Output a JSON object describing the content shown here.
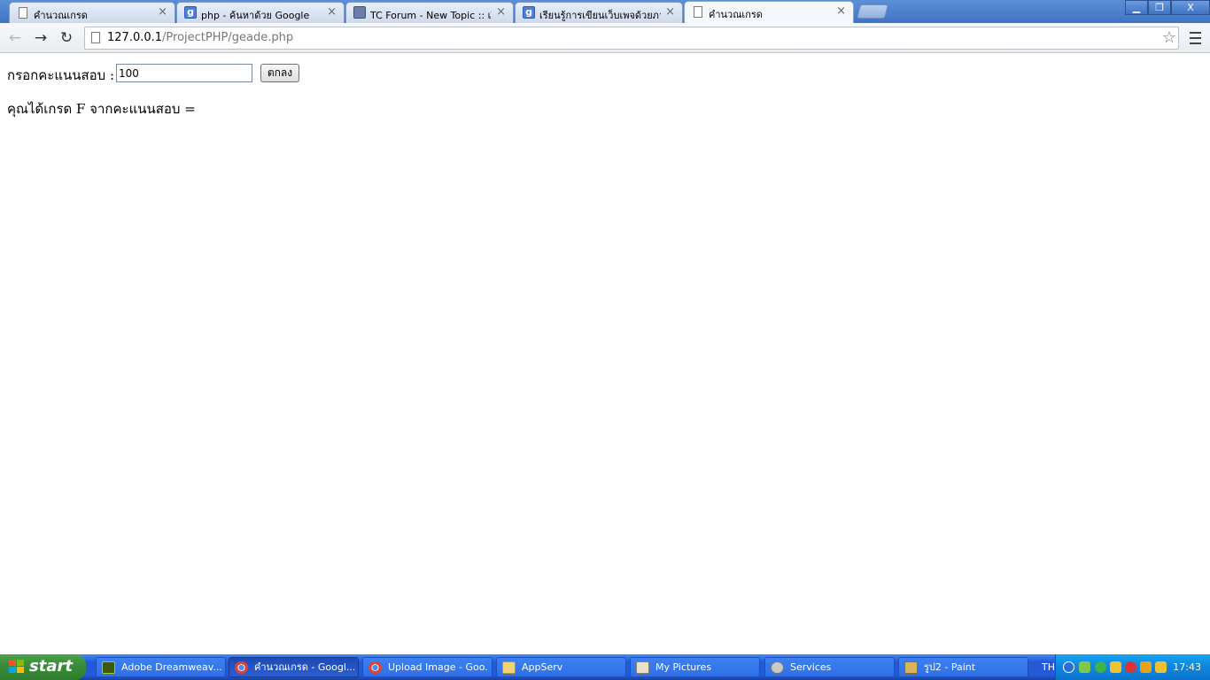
{
  "browser": {
    "tabs": [
      {
        "title": "คำนวณเกรด",
        "icon": "page-icon",
        "active": false
      },
      {
        "title": "php - ค้นหาด้วย Google",
        "icon": "google-icon",
        "active": false
      },
      {
        "title": "TC Forum - New Topic :: เริ่มกร",
        "icon": "forum-icon",
        "active": false
      },
      {
        "title": "เรียนรู้การเขียนเว็บเพจด้วยภาษา",
        "icon": "google-icon",
        "active": false
      },
      {
        "title": "คำนวณเกรด",
        "icon": "page-icon",
        "active": true
      }
    ],
    "tab_close_glyph": "×",
    "window_controls": {
      "minimize": "▁",
      "restore": "❐",
      "close": "X"
    },
    "url": {
      "host": "127.0.0.1",
      "path": "/ProjectPHP/geade.php"
    },
    "nav": {
      "back": "←",
      "forward": "→",
      "reload": "↻",
      "star": "☆"
    }
  },
  "page": {
    "score_label": "กรอกคะแนนสอบ :",
    "score_value": "100",
    "submit_label": "ตกลง",
    "result_text": "คุณได้เกรด F จากคะแนนสอบ ="
  },
  "taskbar": {
    "start_label": "start",
    "tasks": [
      {
        "label": "Adobe Dreamweav...",
        "icon": "dreamweaver-icon",
        "active": false
      },
      {
        "label": "คำนวณเกรด - Googl...",
        "icon": "chrome-icon",
        "active": true
      },
      {
        "label": "Upload Image - Goo...",
        "icon": "chrome-icon",
        "active": false
      },
      {
        "label": "AppServ",
        "icon": "folder-icon",
        "active": false
      },
      {
        "label": "My Pictures",
        "icon": "pictures-icon",
        "active": false
      },
      {
        "label": "Services",
        "icon": "services-icon",
        "active": false
      },
      {
        "label": "รูป2 - Paint",
        "icon": "paint-icon",
        "active": false
      }
    ],
    "language": "TH",
    "clock": "17:43"
  }
}
